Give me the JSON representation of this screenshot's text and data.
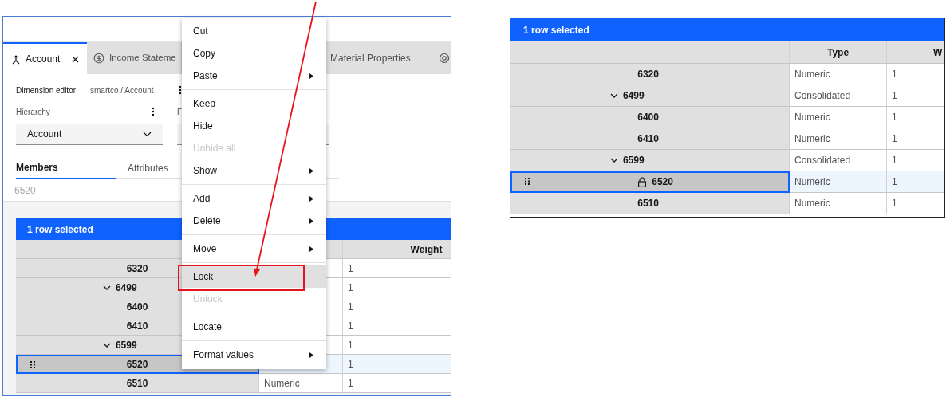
{
  "left_window": {
    "tabs": [
      {
        "label": "Account",
        "selected": true,
        "closable": true
      },
      {
        "label": "Income Stateme",
        "selected": false,
        "closable": false
      },
      {
        "label": "Material Properties",
        "selected": false,
        "closable": false
      },
      {
        "selected": false,
        "closable": false
      }
    ],
    "breadcrumb": {
      "title": "Dimension editor",
      "path": "smartco / Account"
    },
    "hierarchy": {
      "label": "Hierarchy",
      "value": "Account"
    },
    "second_field": {
      "label": "F"
    },
    "view_tabs": [
      {
        "label": "Members",
        "selected": true
      },
      {
        "label": "Attributes",
        "selected": false
      }
    ],
    "current_member": "6520",
    "table": {
      "banner": "1 row selected",
      "weight_header": "Weight",
      "rows": [
        {
          "member": "6320",
          "selected": false,
          "weight": "1"
        },
        {
          "member": "6499",
          "selected": false,
          "expanded": true,
          "weight": "1",
          "children": [
            {
              "member": "6400",
              "selected": false,
              "weight": "1"
            },
            {
              "member": "6410",
              "selected": false,
              "weight": "1"
            }
          ]
        },
        {
          "member": "6599",
          "selected": false,
          "expanded": true,
          "weight": "1",
          "children": [
            {
              "member": "6520",
              "selected": true,
              "weight": "1"
            },
            {
              "member": "6510",
              "selected": false,
              "type": "Numeric",
              "weight": "1"
            }
          ]
        }
      ]
    }
  },
  "context_menu": {
    "groups": [
      {
        "items": [
          {
            "label": "Cut",
            "disabled": false,
            "submenu": false,
            "highlighted": false
          },
          {
            "label": "Copy",
            "disabled": false,
            "submenu": false,
            "highlighted": false
          },
          {
            "label": "Paste",
            "disabled": false,
            "submenu": true,
            "highlighted": false
          }
        ]
      },
      {
        "items": [
          {
            "label": "Keep",
            "disabled": false,
            "submenu": false,
            "highlighted": false
          },
          {
            "label": "Hide",
            "disabled": false,
            "submenu": false,
            "highlighted": false
          },
          {
            "label": "Unhide all",
            "disabled": true,
            "submenu": false,
            "highlighted": false
          },
          {
            "label": "Show",
            "disabled": false,
            "submenu": true,
            "highlighted": false
          }
        ]
      },
      {
        "items": [
          {
            "label": "Add",
            "disabled": false,
            "submenu": true,
            "highlighted": false
          },
          {
            "label": "Delete",
            "disabled": false,
            "submenu": true,
            "highlighted": false
          }
        ]
      },
      {
        "items": [
          {
            "label": "Move",
            "disabled": false,
            "submenu": true,
            "highlighted": false
          }
        ]
      },
      {
        "items": [
          {
            "label": "Lock",
            "disabled": false,
            "submenu": false,
            "highlighted": true
          },
          {
            "label": "Unlock",
            "disabled": true,
            "submenu": false,
            "highlighted": false
          }
        ]
      },
      {
        "items": [
          {
            "label": "Locate",
            "disabled": false,
            "submenu": false,
            "highlighted": false
          }
        ]
      },
      {
        "items": [
          {
            "label": "Format values",
            "disabled": false,
            "submenu": true,
            "highlighted": false
          }
        ]
      }
    ]
  },
  "right_window": {
    "table": {
      "banner": "1 row selected",
      "type_header": "Type",
      "weight_header": "W",
      "rows": [
        {
          "member": "6320",
          "selected": false,
          "locked": false,
          "type": "Numeric",
          "weight": "1"
        },
        {
          "member": "6499",
          "selected": false,
          "locked": false,
          "expanded": true,
          "type": "Consolidated",
          "weight": "1",
          "children": [
            {
              "member": "6400",
              "selected": false,
              "locked": false,
              "type": "Numeric",
              "weight": "1"
            },
            {
              "member": "6410",
              "selected": false,
              "locked": false,
              "type": "Numeric",
              "weight": "1"
            }
          ]
        },
        {
          "member": "6599",
          "selected": false,
          "locked": false,
          "expanded": true,
          "type": "Consolidated",
          "weight": "1",
          "children": [
            {
              "member": "6520",
              "selected": true,
              "locked": true,
              "type": "Numeric",
              "weight": "1"
            },
            {
              "member": "6510",
              "selected": false,
              "locked": false,
              "type": "Numeric",
              "weight": "1"
            }
          ]
        }
      ]
    }
  }
}
